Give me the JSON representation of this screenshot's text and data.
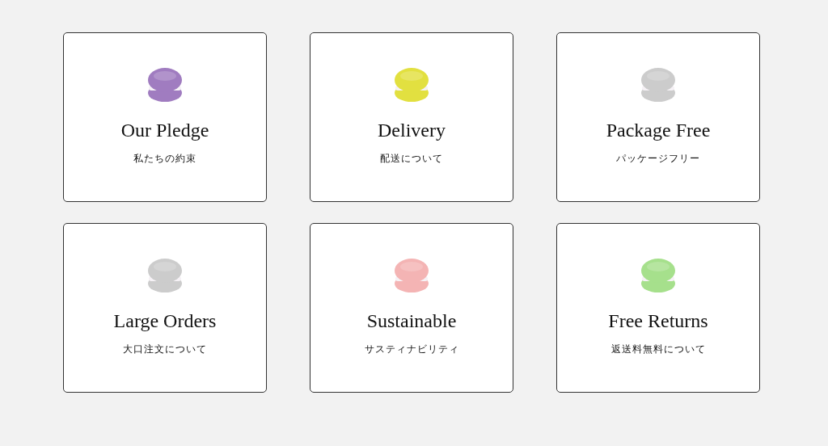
{
  "cards": [
    {
      "title": "Our Pledge",
      "subtitle": "私たちの約束",
      "color": "#a07cc0"
    },
    {
      "title": "Delivery",
      "subtitle": "配送について",
      "color": "#e2e040"
    },
    {
      "title": "Package Free",
      "subtitle": "パッケージフリー",
      "color": "#cccccc"
    },
    {
      "title": "Large Orders",
      "subtitle": "大口注文について",
      "color": "#cccccc"
    },
    {
      "title": "Sustainable",
      "subtitle": "サスティナビリティ",
      "color": "#f4b4b4"
    },
    {
      "title": "Free Returns",
      "subtitle": "返送料無料について",
      "color": "#a6e08c"
    }
  ]
}
